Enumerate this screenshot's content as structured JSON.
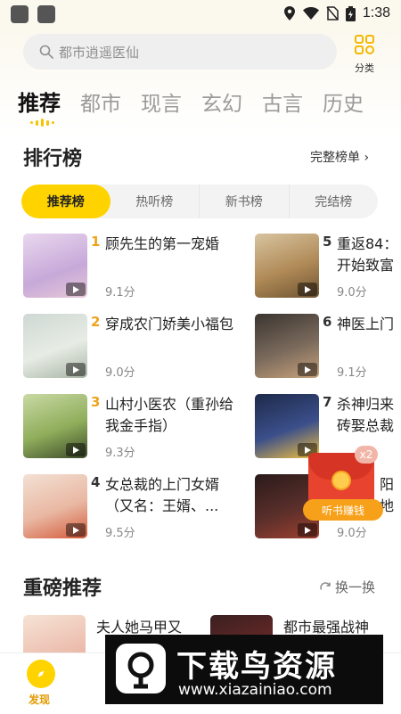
{
  "status_bar": {
    "time": "1:38"
  },
  "search": {
    "placeholder": "都市逍遥医仙"
  },
  "category": {
    "label": "分类"
  },
  "tabs": [
    {
      "label": "推荐",
      "active": true
    },
    {
      "label": "都市",
      "active": false
    },
    {
      "label": "现言",
      "active": false
    },
    {
      "label": "玄幻",
      "active": false
    },
    {
      "label": "古言",
      "active": false
    },
    {
      "label": "历史",
      "active": false
    }
  ],
  "ranking": {
    "title": "排行榜",
    "more": "完整榜单",
    "segments": [
      "推荐榜",
      "热听榜",
      "新书榜",
      "完结榜"
    ],
    "books": [
      {
        "rank": "1",
        "title": "顾先生的第一宠婚",
        "score": "9.1分"
      },
      {
        "rank": "2",
        "title": "穿成农门娇美小福包",
        "score": "9.0分"
      },
      {
        "rank": "3",
        "title": "山村小医农（重孙给我金手指）",
        "score": "9.3分"
      },
      {
        "rank": "4",
        "title": "女总裁的上门女婿（又名：王婿、...",
        "score": "9.5分"
      },
      {
        "rank": "5",
        "title": "重返84：开始致富",
        "score": "9.0分"
      },
      {
        "rank": "6",
        "title": "神医上门",
        "score": "9.1分"
      },
      {
        "rank": "7",
        "title": "杀神归来砖娶总裁",
        "score": ""
      },
      {
        "rank": "8",
        "title": "阳地",
        "score": "9.0分"
      }
    ]
  },
  "redpacket": {
    "badge": "x2",
    "label": "听书赚钱"
  },
  "recommend": {
    "title": "重磅推荐",
    "refresh": "换一换",
    "items": [
      {
        "title": "夫人她马甲又"
      },
      {
        "title": "都市最强战神"
      }
    ]
  },
  "tabbar": {
    "discover": "发现"
  },
  "watermark": {
    "brand": "下载鸟资源",
    "url": "www.xiazainiao.com"
  },
  "colors": {
    "accent": "#ffd300",
    "rank_orange": "#f0a11a",
    "redpacket": "#e8432f"
  }
}
